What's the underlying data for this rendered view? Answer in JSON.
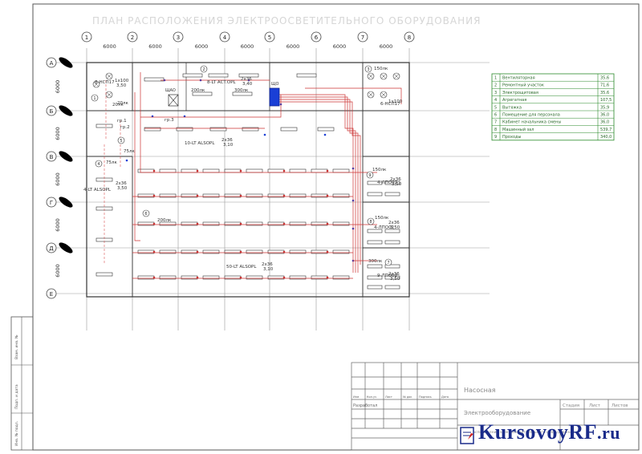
{
  "title": "ПЛАН РАСПОЛОЖЕНИЯ ЭЛЕКТРООСВЕТИТЕЛЬНОГО ОБОРУДОВАНИЯ",
  "axes_columns": [
    "1",
    "2",
    "3",
    "4",
    "5",
    "6",
    "7",
    "8"
  ],
  "axes_rows": [
    "А",
    "Б",
    "В",
    "Г",
    "Д",
    "Е"
  ],
  "span_label": "6000",
  "rooms": [
    {
      "num": "1",
      "name": "Вентиляторная",
      "area": "35,6"
    },
    {
      "num": "2",
      "name": "Ремонтный участок",
      "area": "71,6"
    },
    {
      "num": "3",
      "name": "Электрощитовая",
      "area": "35,6"
    },
    {
      "num": "4",
      "name": "Агрегатная",
      "area": "107,5"
    },
    {
      "num": "5",
      "name": "Вытяжка",
      "area": "35,9"
    },
    {
      "num": "6",
      "name": "Помещение для персонала",
      "area": "36,0"
    },
    {
      "num": "7",
      "name": "Кабинет начальника смены",
      "area": "36,0"
    },
    {
      "num": "8",
      "name": "Машинный зал",
      "area": "539,7"
    },
    {
      "num": "9",
      "name": "Проходы",
      "area": "340,0"
    }
  ],
  "labels": {
    "l1": "8-НСП17",
    "l2": "1х100",
    "l3": "3,50",
    "l4": "20лк",
    "l5": "8-LT ACT.OPL",
    "l6": "2х36",
    "l7": "3,40",
    "l8": "200лк",
    "l9": "300лк",
    "l10": "10-LT ALSOPL",
    "l11": "2х36",
    "l12": "3,10",
    "l13": "4-LT ALSOPL",
    "l14": "2х36",
    "l15": "3,50",
    "l16": "75лк",
    "l17": "4-ЛПО02",
    "l18": "2х36",
    "l19": "3,50",
    "l20": "150лк",
    "l21": "4-ЛПО02",
    "l22": "2х36",
    "l23": "3,50",
    "l24": "150лк",
    "l25": "50-LT ALSOPL",
    "l26": "2х36",
    "l27": "3,10",
    "l28": "200лк",
    "l29": "9-ЛПО02",
    "l30": "2х36",
    "l31": "3,50",
    "l32": "300лк",
    "l33": "150лк",
    "l34": "6-НСП17",
    "l35": "1х100",
    "l36": "ЩО",
    "l37": "ЩАО",
    "l38": "гр.3",
    "l39": "гр.1",
    "l40": "гр.2",
    "l41": "75лк",
    "l42": "20лк"
  },
  "stamp": {
    "name": "Насосная",
    "subtitle": "Электрооборудование",
    "sheet_title": "План расположения электроосветительного оборудования",
    "stage": "Стадия",
    "sheet": "Лист",
    "sheets": "Листов",
    "developed": "Разработал",
    "cols": [
      "Изм",
      "Кол.уч",
      "Лист",
      "№ док",
      "Подпись",
      "Дата"
    ]
  },
  "side_stamp": [
    "Инв. № подл.",
    "Подп. и дата",
    "Взам. инв. №"
  ],
  "watermark": {
    "main": "KursovoyRF",
    "suffix": ".ru"
  }
}
